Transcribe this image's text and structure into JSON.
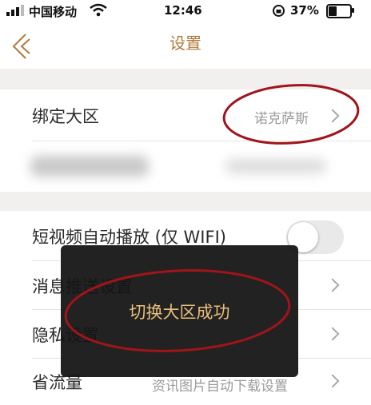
{
  "status_bar": {
    "carrier": "中国移动",
    "time": "12:46",
    "battery": "37%"
  },
  "nav": {
    "title": "设置",
    "back_icon": "chevron-left-icon"
  },
  "rows": {
    "bind_region": {
      "label": "绑定大区",
      "value": "诺克萨斯"
    },
    "autoplay": {
      "label": "短视频自动播放 (仅 WIFI)",
      "enabled": false
    },
    "push": {
      "label": "消息推送设置"
    },
    "privacy": {
      "label": "隐私设置"
    },
    "data_saver": {
      "label": "省流量",
      "value": "资讯图片自动下载设置"
    }
  },
  "toast": {
    "text": "切换大区成功"
  },
  "colors": {
    "accent": "#b07a3a",
    "annotation": "#a0141a",
    "toast_text": "#e8c07a"
  }
}
